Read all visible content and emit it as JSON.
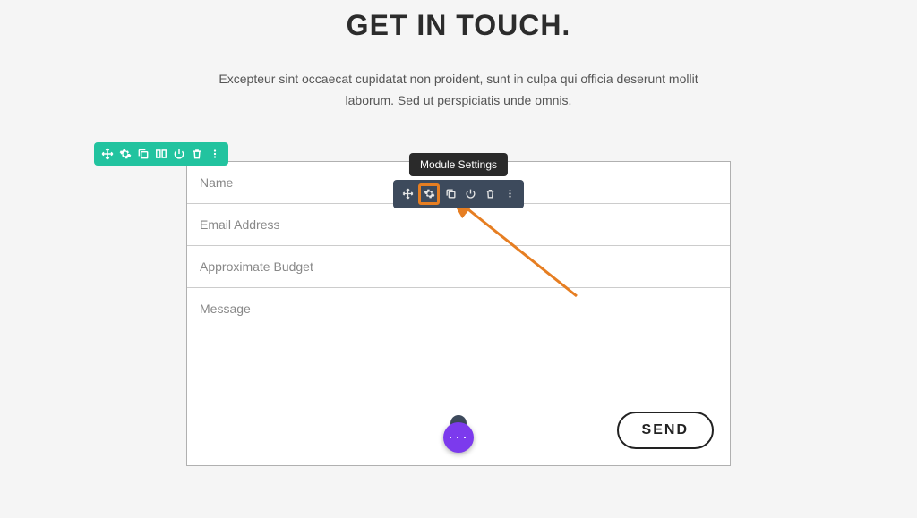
{
  "header": {
    "title": "GET IN TOUCH.",
    "subtitle": "Excepteur sint occaecat cupidatat non proident, sunt in culpa qui officia deserunt mollit laborum. Sed ut perspiciatis unde omnis."
  },
  "form": {
    "fields": {
      "name": "Name",
      "email": "Email Address",
      "budget": "Approximate Budget",
      "message": "Message"
    },
    "submit_label": "SEND"
  },
  "tooltip": {
    "module_settings": "Module Settings"
  },
  "toolbar_icons": {
    "move": "move-icon",
    "settings": "gear-icon",
    "duplicate": "duplicate-icon",
    "save": "save-icon",
    "power": "power-icon",
    "delete": "trash-icon",
    "more": "more-icon",
    "columns": "columns-icon"
  },
  "colors": {
    "section_toolbar": "#22c39f",
    "module_toolbar": "#3d4a5c",
    "highlight": "#e67e22",
    "fab": "#7c3aed"
  }
}
